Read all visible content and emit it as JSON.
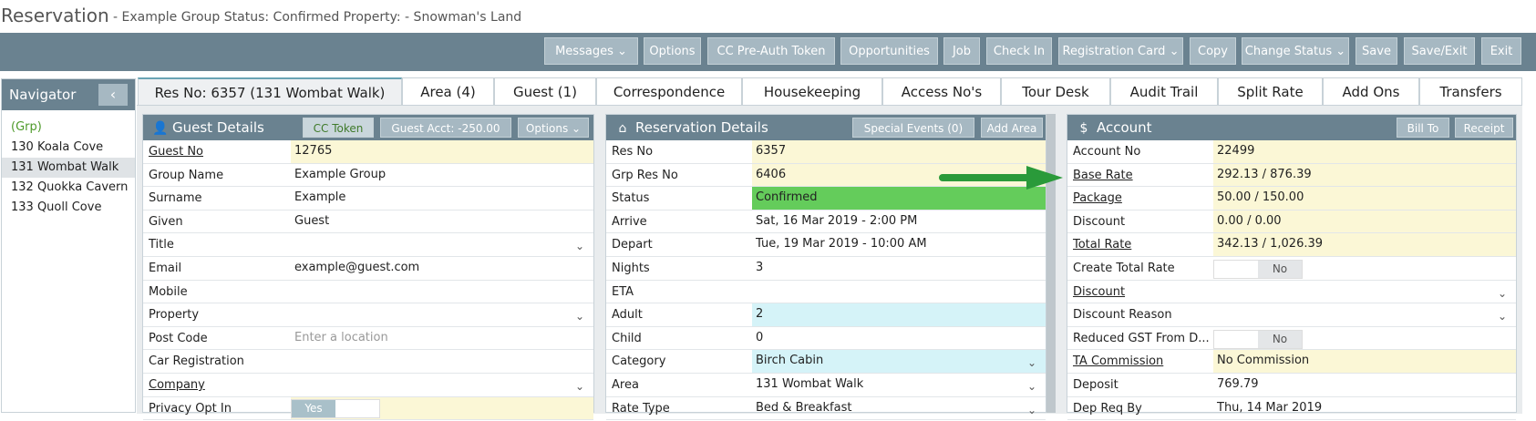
{
  "title": {
    "main": "Reservation",
    "sub": "- Example Group   Status: Confirmed Property: - Snowman's Land"
  },
  "toolbar": {
    "messages": "Messages",
    "options": "Options",
    "cc_preauth": "CC Pre-Auth Token",
    "opportunities": "Opportunities",
    "job": "Job",
    "check_in": "Check In",
    "registration_card": "Registration Card",
    "copy": "Copy",
    "change_status": "Change Status",
    "save": "Save",
    "save_exit": "Save/Exit",
    "exit": "Exit"
  },
  "navigator": {
    "title": "Navigator",
    "items": [
      "(Grp)",
      "130 Koala Cove",
      "131 Wombat Walk",
      "132 Quokka Cavern",
      "133 Quoll Cove"
    ]
  },
  "tabs": [
    "Res No: 6357 (131 Wombat Walk)",
    "Area (4)",
    "Guest (1)",
    "Correspondence",
    "Housekeeping",
    "Access No's",
    "Tour Desk",
    "Audit Trail",
    "Split Rate",
    "Add Ons",
    "Transfers"
  ],
  "guest": {
    "title": "Guest Details",
    "cc_token": "CC Token",
    "guest_acct": "Guest Acct: -250.00",
    "options": "Options",
    "rows": [
      {
        "label": "Guest No",
        "value": "12765"
      },
      {
        "label": "Group Name",
        "value": "Example Group"
      },
      {
        "label": "Surname",
        "value": "Example"
      },
      {
        "label": "Given",
        "value": "Guest"
      },
      {
        "label": "Title",
        "value": ""
      },
      {
        "label": "Email",
        "value": "example@guest.com"
      },
      {
        "label": "Mobile",
        "value": ""
      },
      {
        "label": "Property",
        "value": ""
      },
      {
        "label": "Post Code",
        "value": "",
        "placeholder": "Enter a location"
      },
      {
        "label": "Car Registration",
        "value": ""
      },
      {
        "label": "Company",
        "value": ""
      },
      {
        "label": "Privacy Opt In",
        "value": "Yes"
      }
    ]
  },
  "reservation": {
    "title": "Reservation Details",
    "special_events": "Special Events (0)",
    "add_area": "Add Area",
    "rows": [
      {
        "label": "Res No",
        "value": "6357"
      },
      {
        "label": "Grp Res No",
        "value": "6406"
      },
      {
        "label": "Status",
        "value": "Confirmed"
      },
      {
        "label": "Arrive",
        "value": "Sat, 16 Mar 2019 - 2:00 PM"
      },
      {
        "label": "Depart",
        "value": "Tue, 19 Mar 2019 - 10:00 AM"
      },
      {
        "label": "Nights",
        "value": "3"
      },
      {
        "label": "ETA",
        "value": ""
      },
      {
        "label": "Adult",
        "value": "2"
      },
      {
        "label": "Child",
        "value": "0"
      },
      {
        "label": "Category",
        "value": "Birch Cabin"
      },
      {
        "label": "Area",
        "value": "131 Wombat Walk"
      },
      {
        "label": "Rate Type",
        "value": "Bed & Breakfast"
      }
    ]
  },
  "account": {
    "title": "Account",
    "bill_to": "Bill To",
    "receipt": "Receipt",
    "rows": [
      {
        "label": "Account No",
        "value": "22499"
      },
      {
        "label": "Base Rate",
        "value": "292.13 / 876.39"
      },
      {
        "label": "Package",
        "value": "50.00 / 150.00"
      },
      {
        "label": "Discount",
        "value": "0.00 / 0.00"
      },
      {
        "label": "Total Rate",
        "value": "342.13 / 1,026.39"
      },
      {
        "label": "Create Total Rate",
        "value": "No"
      },
      {
        "label": "Discount",
        "value": ""
      },
      {
        "label": "Discount Reason",
        "value": ""
      },
      {
        "label": "Reduced GST From D...",
        "value": "No"
      },
      {
        "label": "TA Commission",
        "value": "No Commission"
      },
      {
        "label": "Deposit",
        "value": "769.79"
      },
      {
        "label": "Dep Req By",
        "value": "Thu, 14 Mar 2019"
      }
    ]
  },
  "colors": {
    "toolbar": "#6a8290",
    "status_green": "#64cc5b",
    "highlight_yellow": "#fbf7d6",
    "arrow_green": "#2a9a3a"
  }
}
